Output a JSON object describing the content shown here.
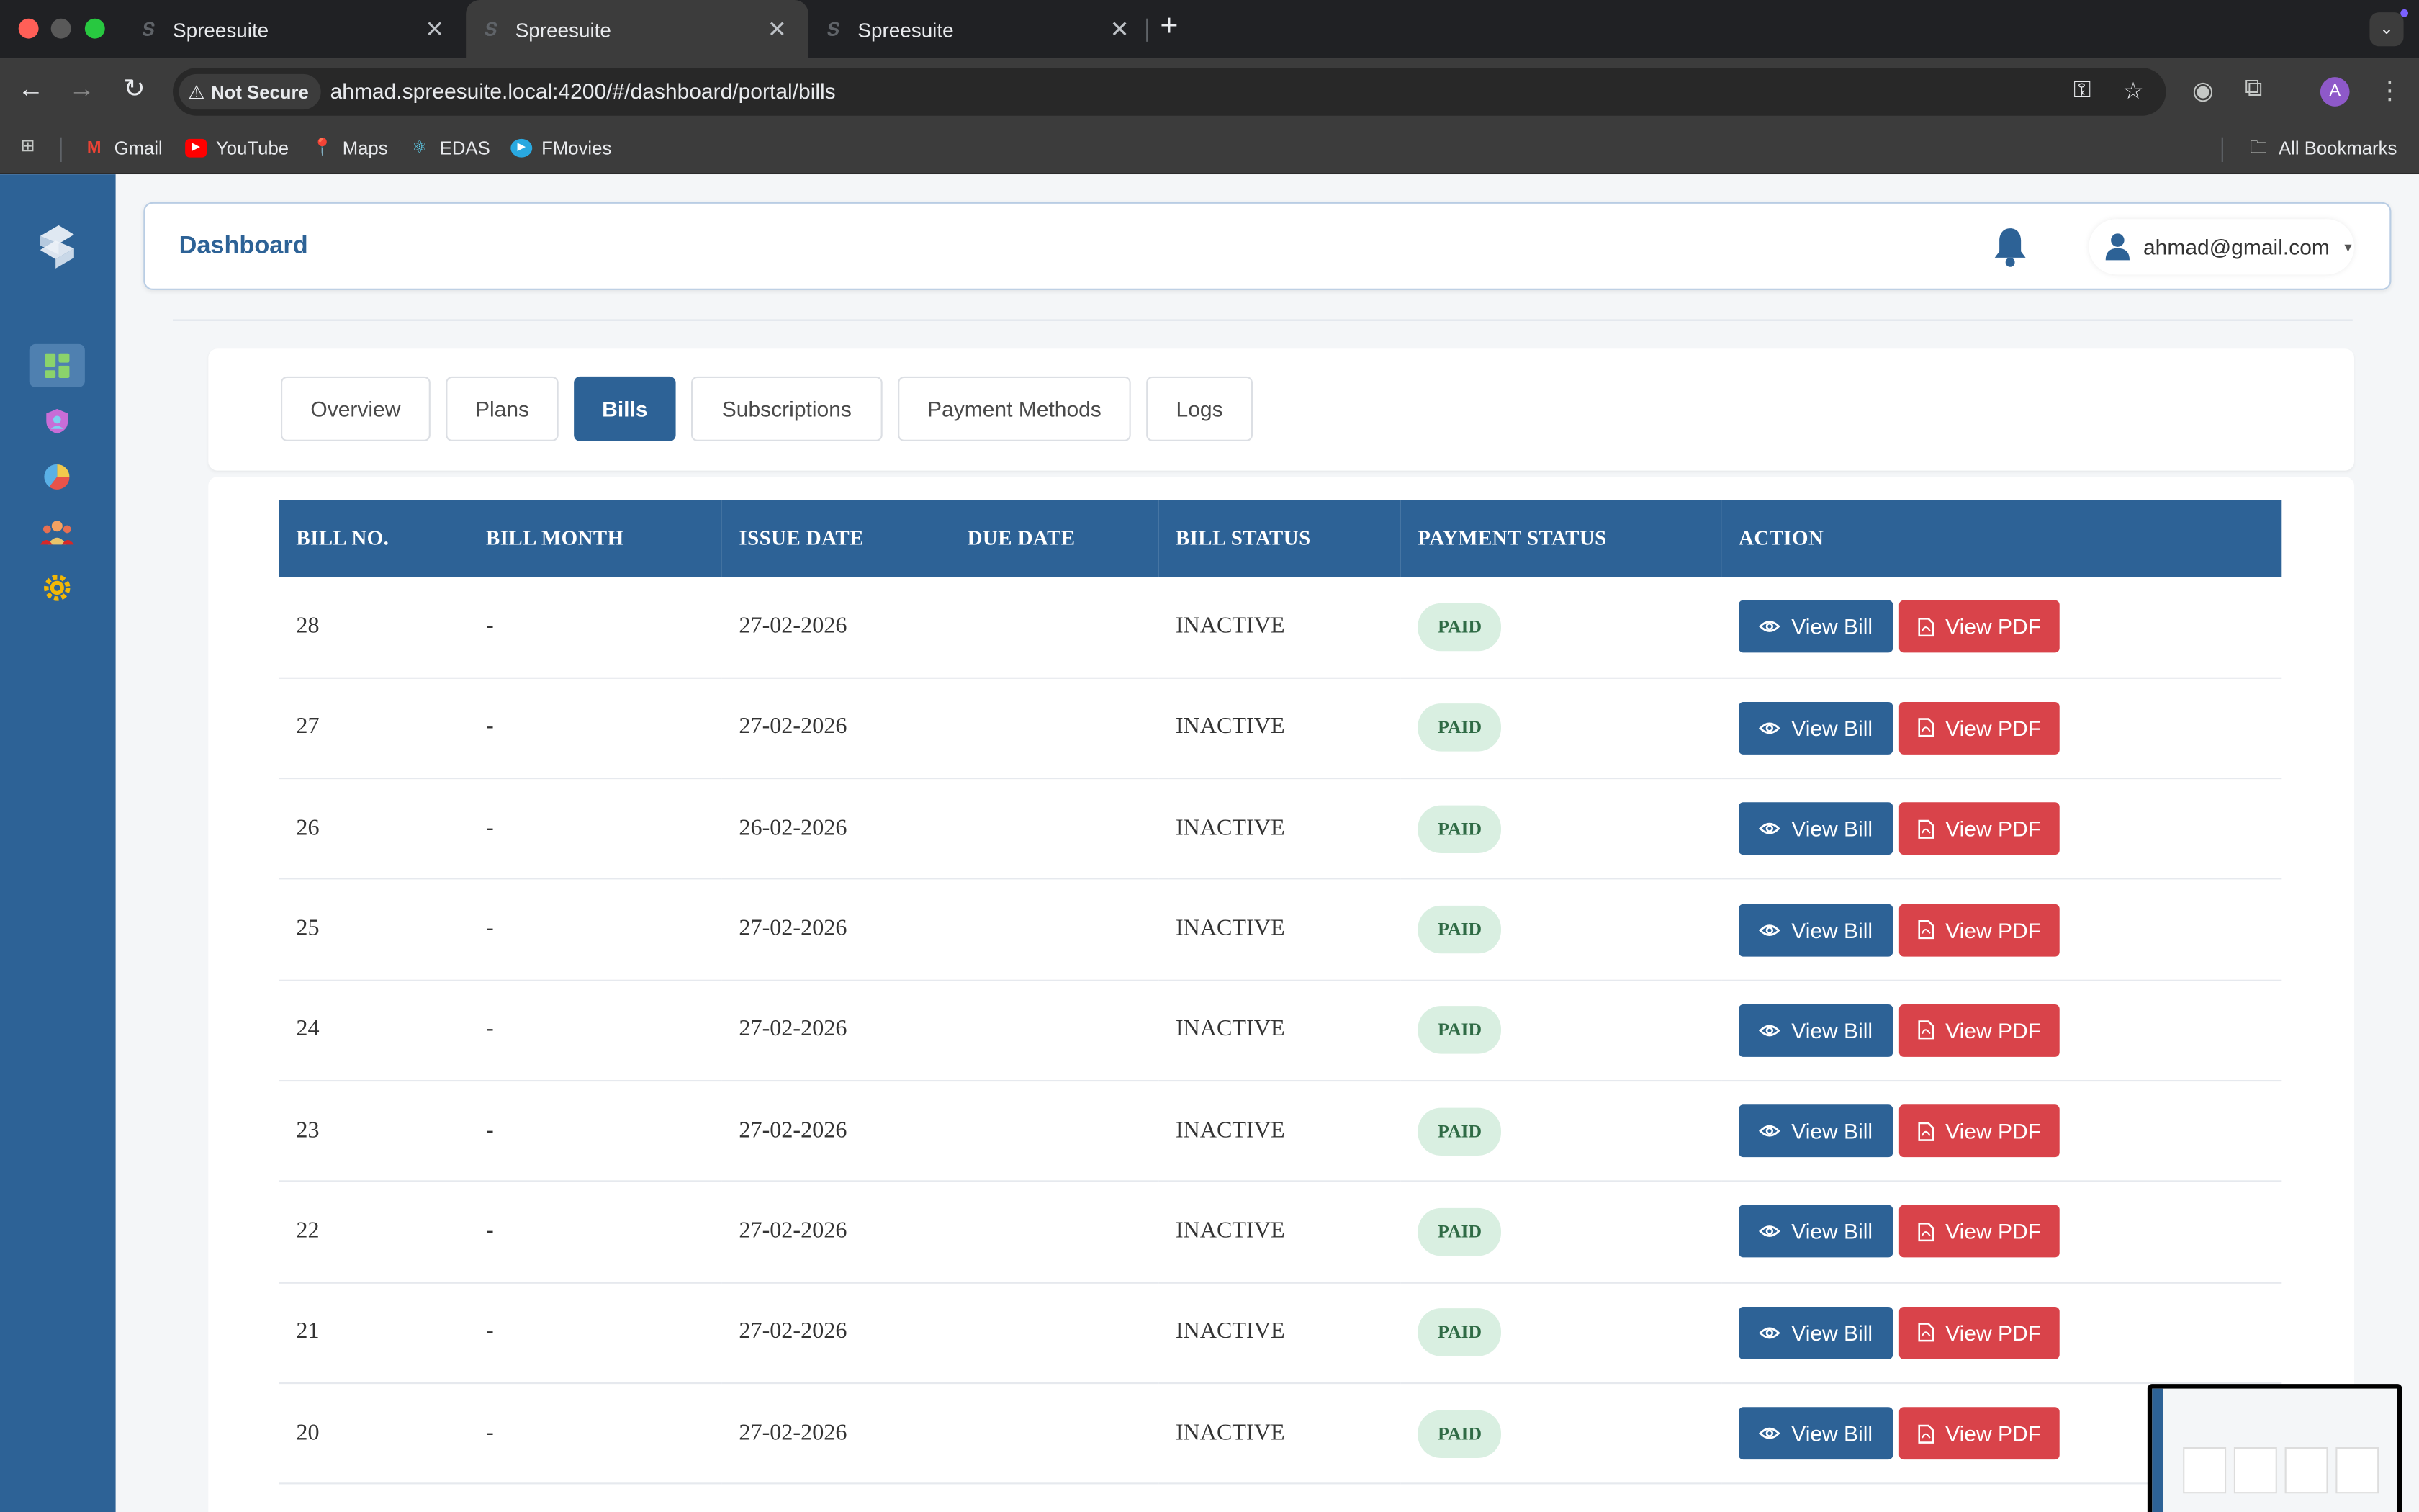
{
  "browser": {
    "tabs": [
      {
        "title": "Spreesuite",
        "active": false
      },
      {
        "title": "Spreesuite",
        "active": true
      },
      {
        "title": "Spreesuite",
        "active": false
      }
    ],
    "security_label": "Not Secure",
    "url": "ahmad.spreesuite.local:4200/#/dashboard/portal/bills",
    "profile_initial": "A",
    "bookmarks": [
      {
        "label": "Gmail",
        "icon": "gmail-icon"
      },
      {
        "label": "YouTube",
        "icon": "youtube-icon"
      },
      {
        "label": "Maps",
        "icon": "maps-icon"
      },
      {
        "label": "EDAS",
        "icon": "react-icon"
      },
      {
        "label": "FMovies",
        "icon": "play-icon"
      }
    ],
    "all_bookmarks": "All Bookmarks"
  },
  "header": {
    "title": "Dashboard",
    "user_email": "ahmad@gmail.com"
  },
  "portal_tabs": [
    {
      "label": "Overview",
      "active": false
    },
    {
      "label": "Plans",
      "active": false
    },
    {
      "label": "Bills",
      "active": true
    },
    {
      "label": "Subscriptions",
      "active": false
    },
    {
      "label": "Payment Methods",
      "active": false
    },
    {
      "label": "Logs",
      "active": false
    }
  ],
  "table": {
    "columns": [
      "BILL NO.",
      "BILL MONTH",
      "ISSUE DATE",
      "DUE DATE",
      "BILL STATUS",
      "PAYMENT STATUS",
      "ACTION"
    ],
    "view_bill_label": "View Bill",
    "view_pdf_label": "View PDF",
    "rows": [
      {
        "bill_no": "28",
        "bill_month": "-",
        "issue_date": "27-02-2026",
        "due_date": "",
        "bill_status": "INACTIVE",
        "payment_status": "PAID"
      },
      {
        "bill_no": "27",
        "bill_month": "-",
        "issue_date": "27-02-2026",
        "due_date": "",
        "bill_status": "INACTIVE",
        "payment_status": "PAID"
      },
      {
        "bill_no": "26",
        "bill_month": "-",
        "issue_date": "26-02-2026",
        "due_date": "",
        "bill_status": "INACTIVE",
        "payment_status": "PAID"
      },
      {
        "bill_no": "25",
        "bill_month": "-",
        "issue_date": "27-02-2026",
        "due_date": "",
        "bill_status": "INACTIVE",
        "payment_status": "PAID"
      },
      {
        "bill_no": "24",
        "bill_month": "-",
        "issue_date": "27-02-2026",
        "due_date": "",
        "bill_status": "INACTIVE",
        "payment_status": "PAID"
      },
      {
        "bill_no": "23",
        "bill_month": "-",
        "issue_date": "27-02-2026",
        "due_date": "",
        "bill_status": "INACTIVE",
        "payment_status": "PAID"
      },
      {
        "bill_no": "22",
        "bill_month": "-",
        "issue_date": "27-02-2026",
        "due_date": "",
        "bill_status": "INACTIVE",
        "payment_status": "PAID"
      },
      {
        "bill_no": "21",
        "bill_month": "-",
        "issue_date": "27-02-2026",
        "due_date": "",
        "bill_status": "INACTIVE",
        "payment_status": "PAID"
      },
      {
        "bill_no": "20",
        "bill_month": "-",
        "issue_date": "27-02-2026",
        "due_date": "",
        "bill_status": "INACTIVE",
        "payment_status": "PAID"
      }
    ]
  },
  "colors": {
    "primary": "#2d6296",
    "danger": "#d9434a",
    "paid_bg": "#d9efe1",
    "paid_text": "#2f6b45"
  }
}
